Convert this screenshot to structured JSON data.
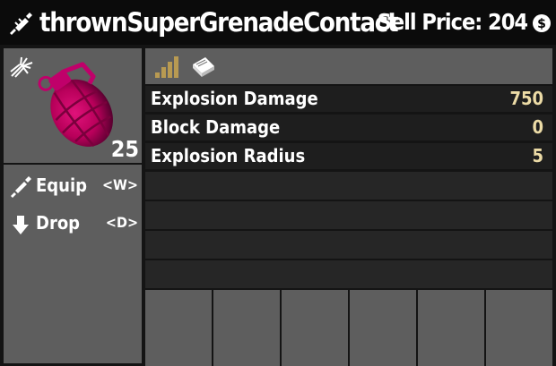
{
  "header": {
    "item_name": "thrownSuperGrenadeContact",
    "sell_label": "Sell Price: 204",
    "item_icon": "grenade-throw-icon",
    "currency_icon": "dukes-coin-icon"
  },
  "preview": {
    "category_icon": "explosion-icon",
    "item_image": "grenade-image",
    "quantity": "25"
  },
  "actions": [
    {
      "label": "Equip",
      "key": "<W>",
      "icon": "equip-icon"
    },
    {
      "label": "Drop",
      "key": "<D>",
      "icon": "drop-arrow-icon"
    }
  ],
  "iconbar": {
    "quality_icon": "quality-bars-icon",
    "book_icon": "book-icon"
  },
  "stats": [
    {
      "name": "Explosion Damage",
      "value": "750"
    },
    {
      "name": "Block Damage",
      "value": "0"
    },
    {
      "name": "Explosion Radius",
      "value": "5"
    }
  ],
  "colors": {
    "stat_value": "#ecdba6",
    "grenade": "#b8005a",
    "quality": "#b89a52"
  }
}
